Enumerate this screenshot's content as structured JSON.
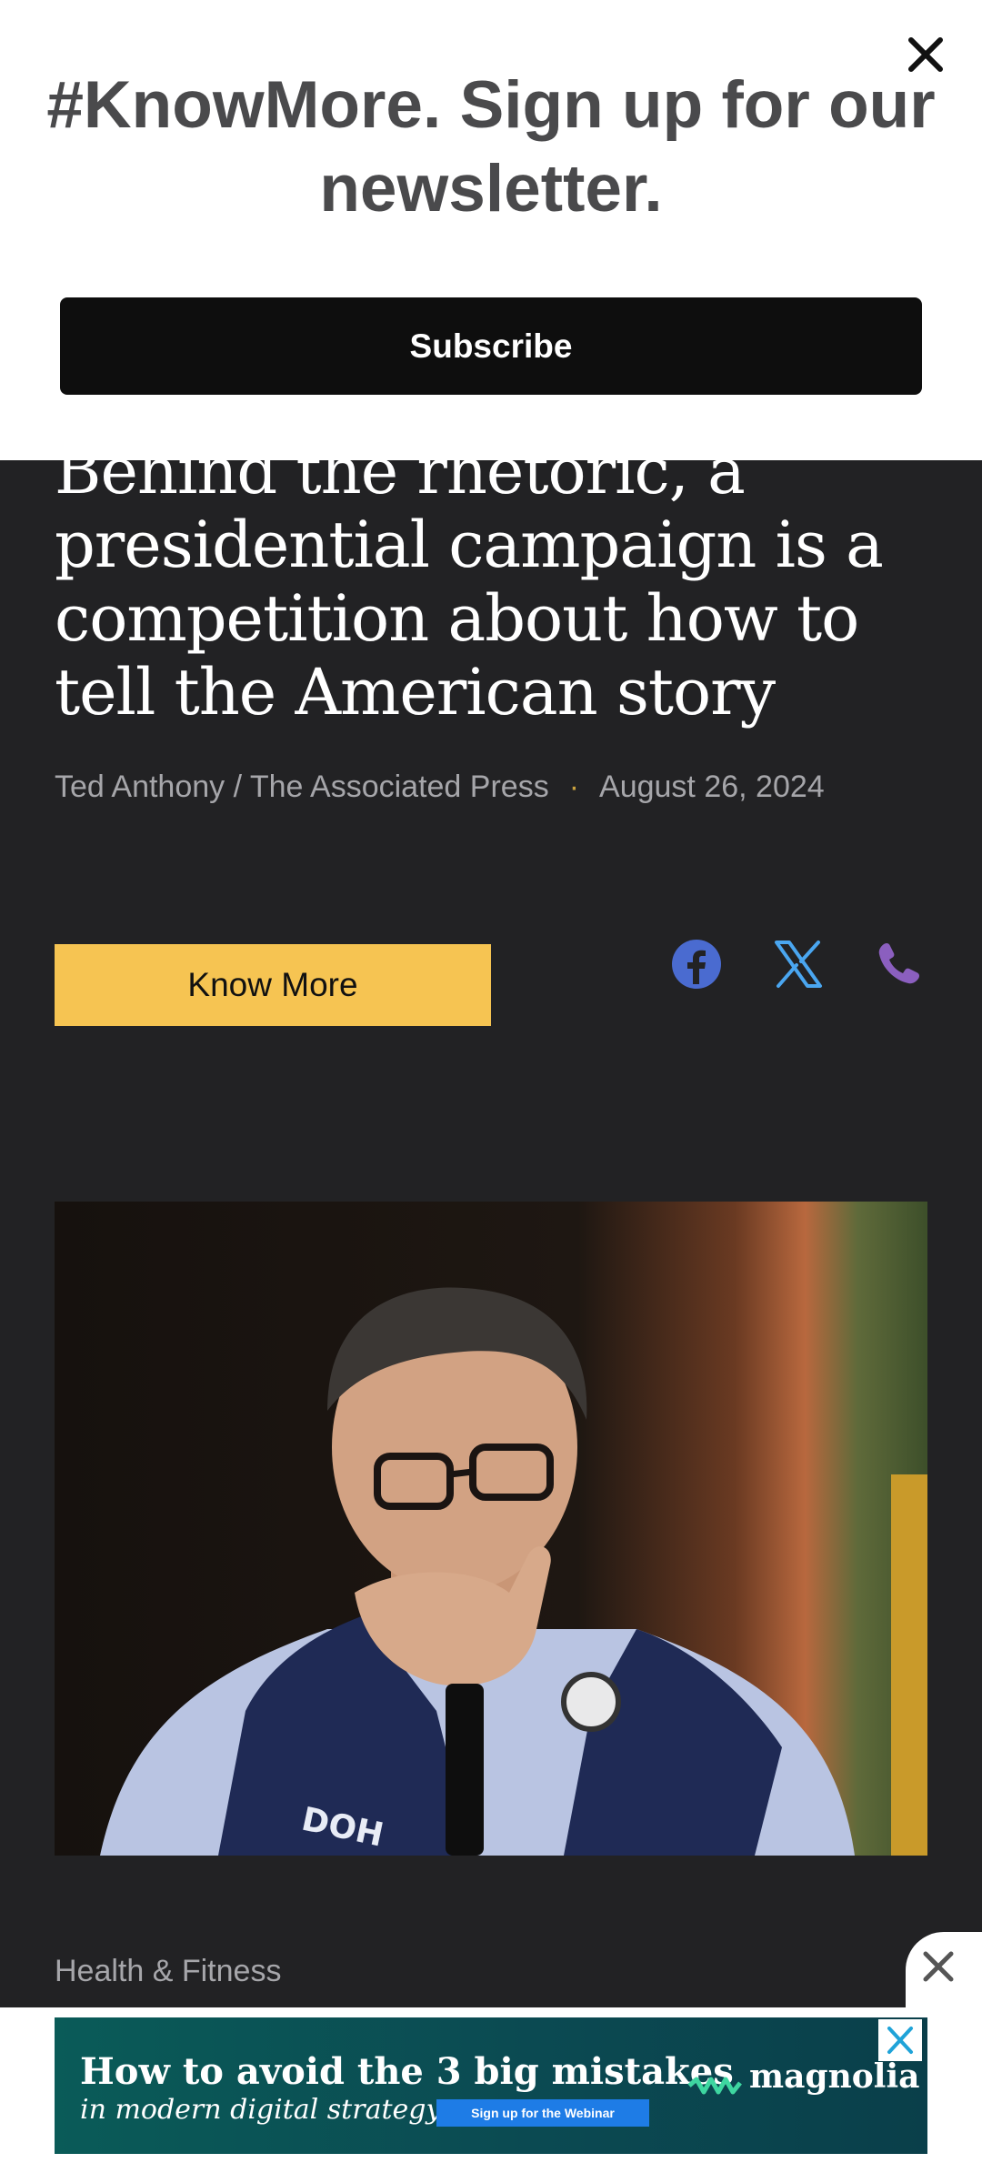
{
  "banner": {
    "title": "#KnowMore. Sign up for our newsletter.",
    "subscribe_label": "Subscribe",
    "close_icon": "close-icon"
  },
  "article": {
    "headline": "Behind the rhetoric, a presidential campaign is a competition about how to tell the American story",
    "author": "Ted Anthony / The Associated Press",
    "separator": "·",
    "date": "August 26, 2024",
    "know_more_label": "Know More",
    "share": [
      {
        "icon": "facebook-icon",
        "color": "#4a6bd0"
      },
      {
        "icon": "x-icon",
        "color": "#4aa6f0"
      },
      {
        "icon": "phone-icon",
        "color": "#8b5fbf"
      }
    ],
    "category": "Health & Fitness"
  },
  "ad": {
    "line1": "How to avoid the 3 big mistakes",
    "line2": "in modern digital strategy",
    "cta": "Sign up for the Webinar",
    "brand": "magnolia"
  },
  "colors": {
    "background": "#222224",
    "accent_button": "#f6c452",
    "subscribe_button": "#0e0e0e"
  }
}
